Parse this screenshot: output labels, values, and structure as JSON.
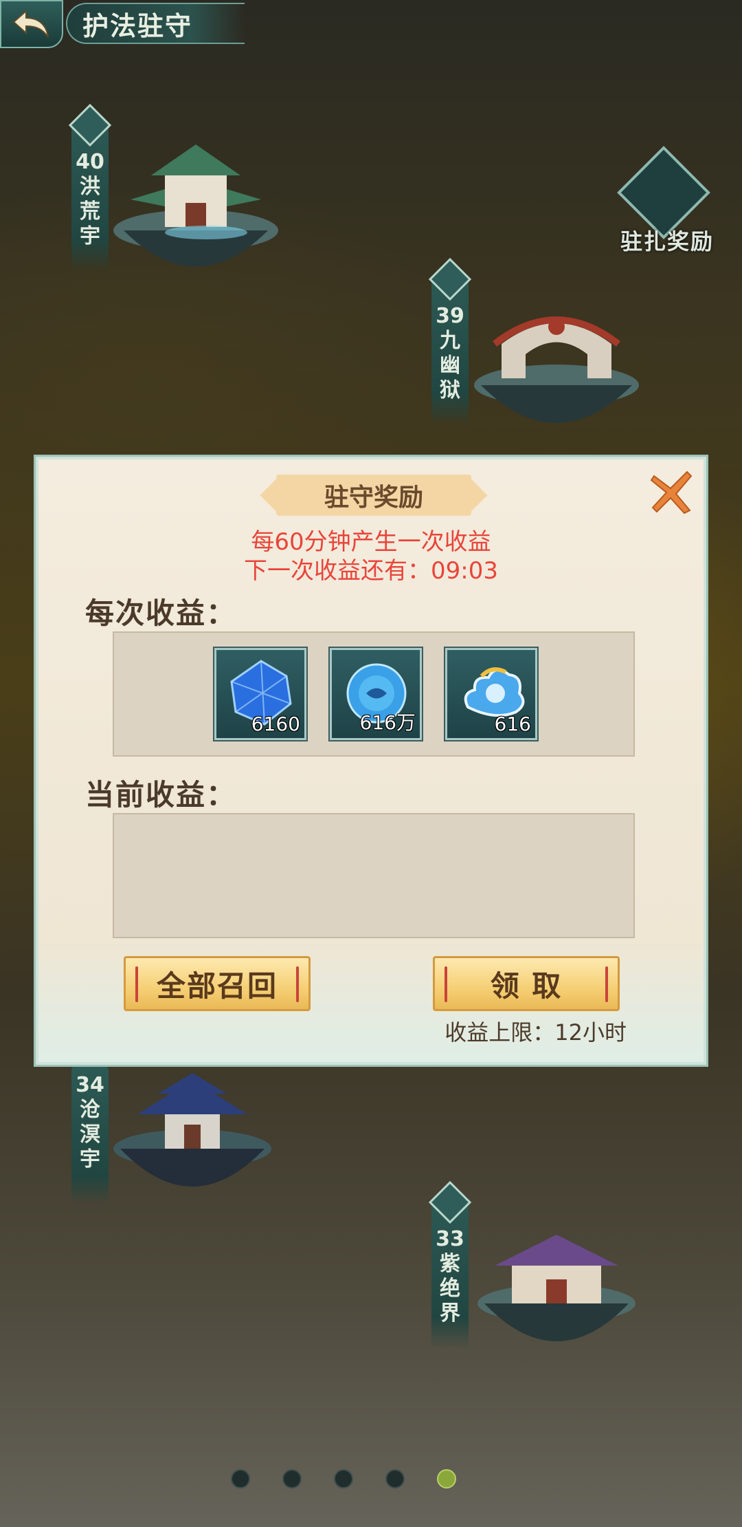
{
  "header": {
    "title": "护法驻守"
  },
  "banners": [
    {
      "num": "40",
      "name": [
        "洪",
        "荒",
        "宇"
      ]
    },
    {
      "num": "39",
      "name": [
        "九",
        "幽",
        "狱"
      ]
    },
    {
      "num": "34",
      "name": [
        "沧",
        "溟",
        "宇"
      ]
    },
    {
      "num": "33",
      "name": [
        "紫",
        "绝",
        "界"
      ]
    }
  ],
  "reward_badge": {
    "label": "驻扎奖励"
  },
  "modal": {
    "title": "驻守奖励",
    "info_line1": "每60分钟产生一次收益",
    "info_line2": "下一次收益还有：09:03",
    "per_label": "每次收益：",
    "items": [
      {
        "icon": "blue-crystal-icon",
        "qty": "6160"
      },
      {
        "icon": "blue-orb-icon",
        "qty": "616万"
      },
      {
        "icon": "cloud-pearl-icon",
        "qty": "616"
      }
    ],
    "current_label": "当前收益：",
    "recall_button": "全部召回",
    "claim_button": "领 取",
    "limit_text": "收益上限：12小时"
  },
  "pager": {
    "count": 5,
    "active_index": 4
  },
  "colors": {
    "accent_red": "#e8453a",
    "button_gold": "#f6cf74",
    "teal": "#2f5e5a"
  }
}
